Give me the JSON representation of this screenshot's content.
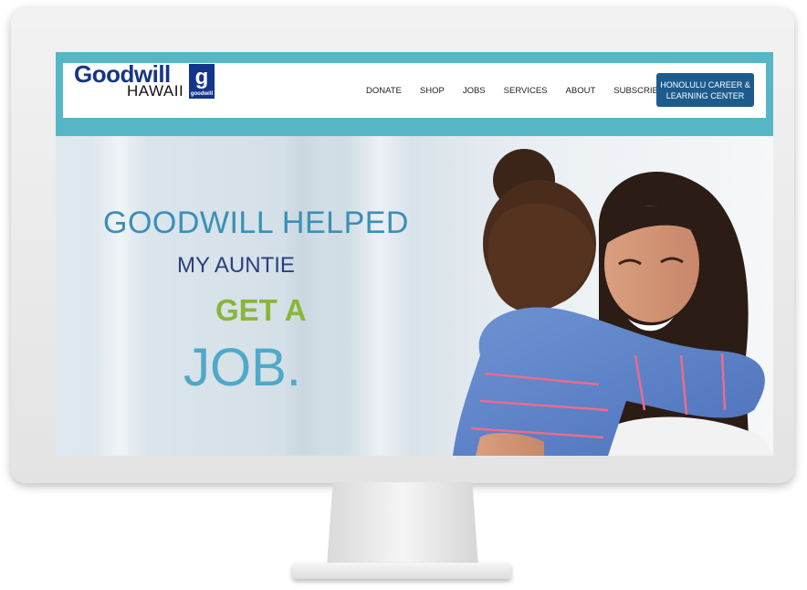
{
  "logo": {
    "word": "Goodwill",
    "region": "HAWAII",
    "mark_letter": "g",
    "mark_text": "goodwill"
  },
  "nav": {
    "items": [
      "DONATE",
      "SHOP",
      "JOBS",
      "SERVICES",
      "ABOUT",
      "SUBSCRIBE!"
    ],
    "cta": "HONOLULU CAREER & LEARNING CENTER"
  },
  "hero": {
    "line1": "GOODWILL HELPED",
    "line2": "MY AUNTIE",
    "line3": "GET A",
    "line4": "JOB."
  },
  "colors": {
    "header_band": "#57b6c6",
    "brand_navy": "#14358a",
    "cta_bg": "#1d5b8c",
    "accent_green": "#8ab53a",
    "accent_teal": "#4fa9c8"
  }
}
